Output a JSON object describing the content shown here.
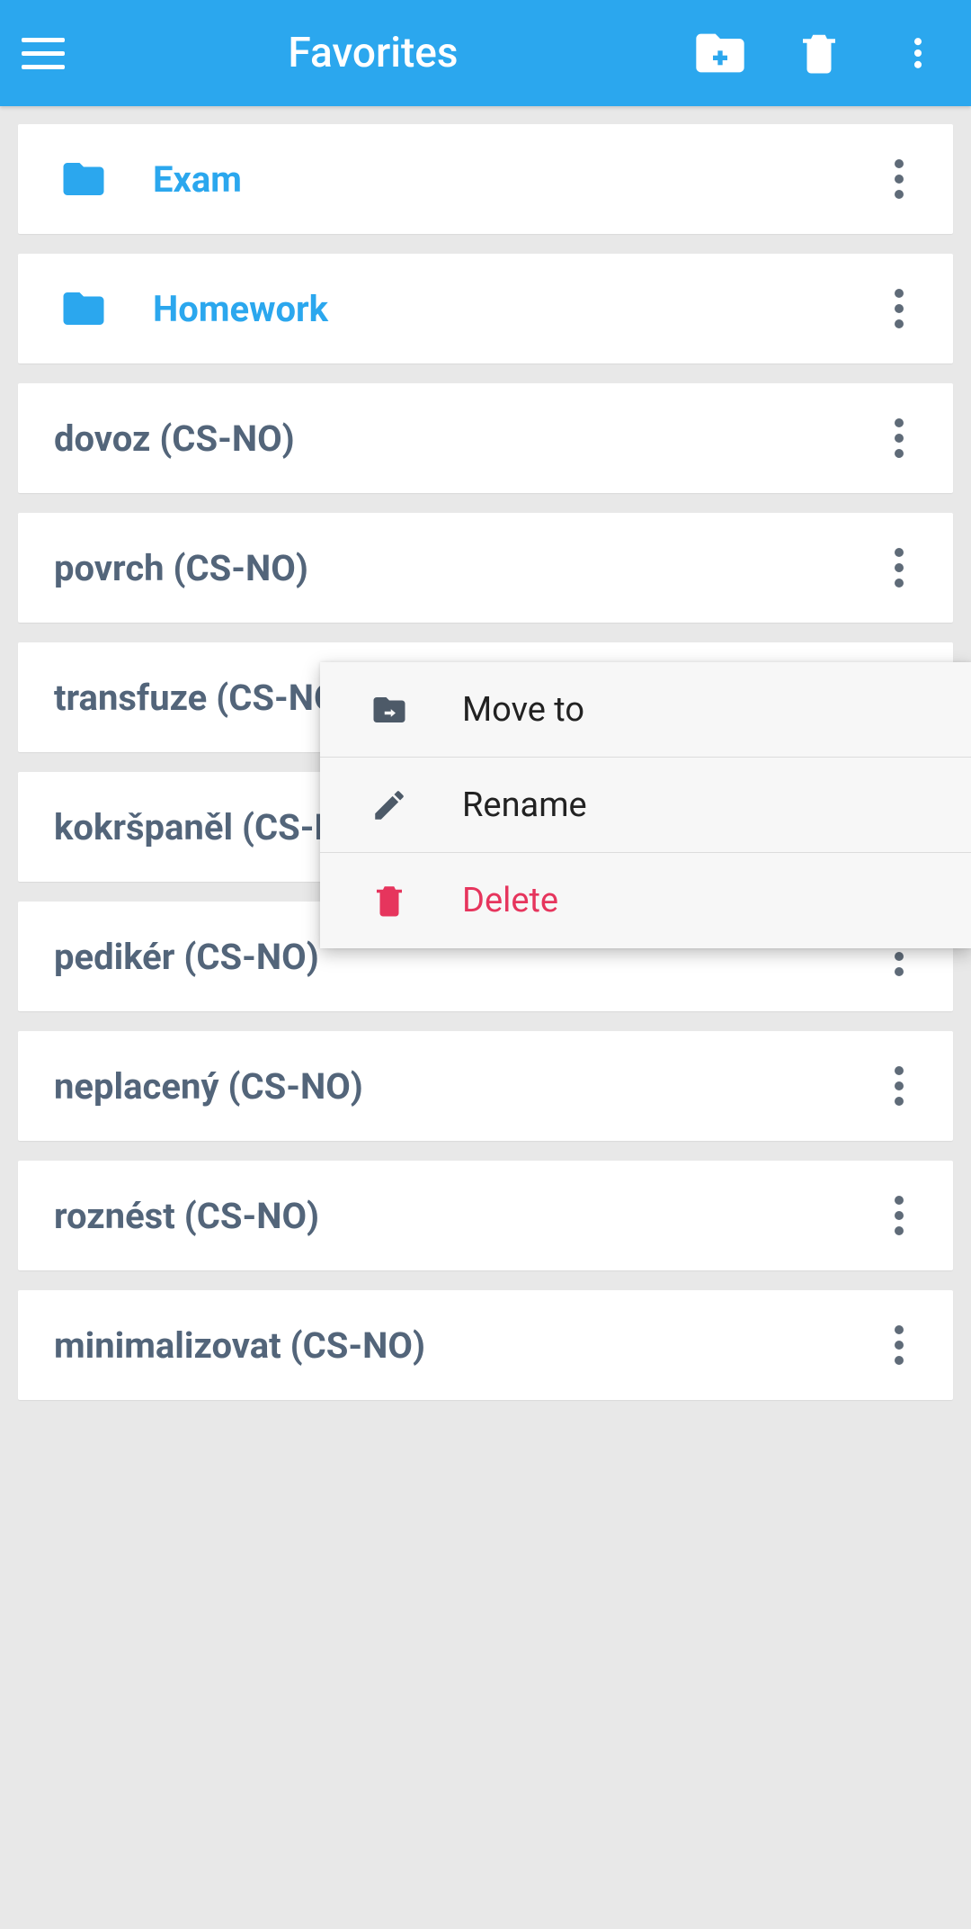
{
  "header": {
    "title": "Favorites"
  },
  "folders": [
    {
      "label": "Exam"
    },
    {
      "label": "Homework"
    }
  ],
  "items": [
    {
      "label": "dovoz (CS-NO)"
    },
    {
      "label": "povrch (CS-NO)"
    },
    {
      "label": "transfuze (CS-NO)"
    },
    {
      "label": "kokršpaněl (CS-NO)"
    },
    {
      "label": "pedikér (CS-NO)"
    },
    {
      "label": "neplacený (CS-NO)"
    },
    {
      "label": "roznést (CS-NO)"
    },
    {
      "label": "minimalizovat (CS-NO)"
    }
  ],
  "menu": {
    "move": "Move to",
    "rename": "Rename",
    "delete": "Delete"
  }
}
